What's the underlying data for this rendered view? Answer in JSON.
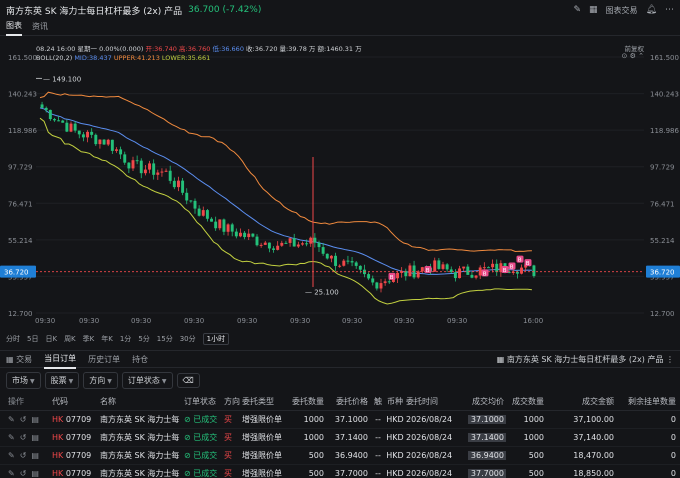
{
  "header": {
    "title": "南方东英 SK 海力士每日杠杆最多 (2x) 产品",
    "price": "36.700 (-7.42%)",
    "actions": [
      "图表交易"
    ],
    "icons": [
      "edit-icon",
      "grid-icon",
      "bell-icon",
      "more-icon"
    ]
  },
  "tabs": [
    "图表",
    "资讯"
  ],
  "chart_info": {
    "date": "08.24 16:00 星期一",
    "change": "0.00%(0.000)",
    "open": "开:36.740",
    "high": "高:36.760",
    "low": "低:36.660",
    "close": "收:36.720",
    "volume": "量:39.78 万",
    "amount": "额:1460.31 万",
    "boll_label": "BOLL(20,2)",
    "mid": "MID:38.437",
    "upper": "UPPER:41.213",
    "lower": "LOWER:35.661",
    "prepost": "前复权",
    "ctl": "⊙ ⚙ ⌃"
  },
  "chart_data": {
    "type": "candlestick",
    "y_ticks": [
      "161.500",
      "140.243",
      "118.986",
      "97.729",
      "76.471",
      "55.214",
      "33.957",
      "12.700"
    ],
    "x_ticks": [
      "09:30",
      "09:30",
      "09:30",
      "09:30",
      "09:30",
      "09:30",
      "09:30",
      "09:30",
      "09:30",
      "16:00"
    ],
    "current_price": "36.720",
    "high_label": "149.100",
    "low_label": "25.100",
    "ylim": [
      12.7,
      161.5
    ]
  },
  "periods": [
    "分时",
    "5日",
    "日K",
    "周K",
    "季K",
    "年K",
    "1分",
    "5分",
    "15分",
    "30分",
    "1小时"
  ],
  "period_selected": "1小时",
  "trade_tabs": [
    "交易",
    "当日订单",
    "历史订单",
    "持仓"
  ],
  "trade_right": "南方东英 SK 海力士每日杠杆最多 (2x) 产品",
  "filters": [
    "市场",
    "股票",
    "方向",
    "订单状态"
  ],
  "columns": [
    "操作",
    "代码",
    "名称",
    "订单状态",
    "方向",
    "委托类型",
    "委托数量",
    "委托价格",
    "触",
    "币种",
    "委托时间",
    "成交均价",
    "成交数量",
    "成交金额",
    "剩余挂单数量"
  ],
  "rows": [
    {
      "market": "HK",
      "code": "07709",
      "name": "南方东英 SK 海力士每",
      "status": "已成交",
      "dir": "买",
      "type": "增强限价单",
      "qty": "1000",
      "price": "37.1000",
      "trig": "--",
      "cur": "HKD",
      "time": "2026/08/24",
      "avg": "37.1000",
      "fqty": "1000",
      "famt": "37,100.00",
      "rem": "0"
    },
    {
      "market": "HK",
      "code": "07709",
      "name": "南方东英 SK 海力士每",
      "status": "已成交",
      "dir": "买",
      "type": "增强限价单",
      "qty": "1000",
      "price": "37.1400",
      "trig": "--",
      "cur": "HKD",
      "time": "2026/08/24",
      "avg": "37.1400",
      "fqty": "1000",
      "famt": "37,140.00",
      "rem": "0"
    },
    {
      "market": "HK",
      "code": "07709",
      "name": "南方东英 SK 海力士每",
      "status": "已成交",
      "dir": "买",
      "type": "增强限价单",
      "qty": "500",
      "price": "36.9400",
      "trig": "--",
      "cur": "HKD",
      "time": "2026/08/24",
      "avg": "36.9400",
      "fqty": "500",
      "famt": "18,470.00",
      "rem": "0"
    },
    {
      "market": "HK",
      "code": "07709",
      "name": "南方东英 SK 海力士每",
      "status": "已成交",
      "dir": "买",
      "type": "增强限价单",
      "qty": "500",
      "price": "37.7000",
      "trig": "--",
      "cur": "HKD",
      "time": "2026/08/24",
      "avg": "37.7000",
      "fqty": "500",
      "famt": "18,850.00",
      "rem": "0"
    }
  ]
}
